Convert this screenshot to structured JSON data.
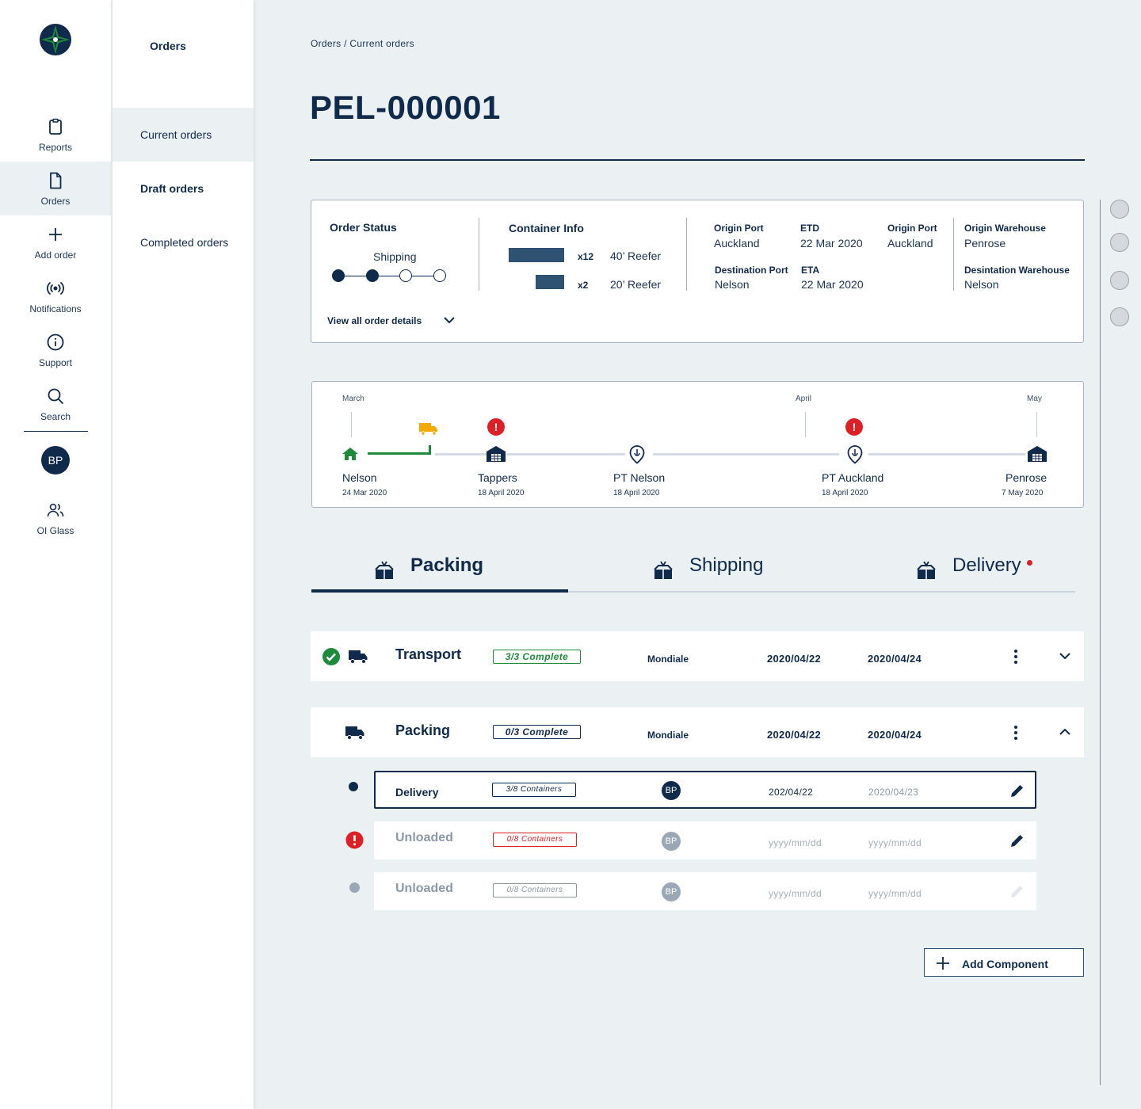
{
  "rail": {
    "items": [
      {
        "label": "Reports",
        "icon": "clipboard-icon"
      },
      {
        "label": "Orders",
        "icon": "document-icon"
      },
      {
        "label": "Add order",
        "icon": "plus-icon"
      },
      {
        "label": "Notifications",
        "icon": "broadcast-icon"
      },
      {
        "label": "Support",
        "icon": "info-icon"
      },
      {
        "label": "Search",
        "icon": "search-icon"
      }
    ],
    "user_initials": "BP",
    "org_label": "OI Glass"
  },
  "subnav": {
    "title": "Orders",
    "items": [
      {
        "label": "Current orders"
      },
      {
        "label": "Draft orders"
      },
      {
        "label": "Completed orders"
      }
    ]
  },
  "breadcrumb": "Orders / Current orders",
  "page_title": "PEL-000001",
  "order_info": {
    "status_label": "Order Status",
    "status_value": "Shipping",
    "status_steps_done": 2,
    "status_steps_total": 4,
    "view_details": "View all order details",
    "container_label": "Container Info",
    "containers": [
      {
        "qty": "x12",
        "type": "40’ Reefer"
      },
      {
        "qty": "x2",
        "type": "20’ Reefer"
      }
    ],
    "origin_port_label": "Origin Port",
    "origin_port": "Auckland",
    "etd_label": "ETD",
    "etd": "22 Mar 2020",
    "origin_port2_label": "Origin Port",
    "origin_port2": "Auckland",
    "dest_port_label": "Destination Port",
    "dest_port": "Nelson",
    "eta_label": "ETA",
    "eta": "22 Mar 2020",
    "origin_wh_label": "Origin Warehouse",
    "origin_wh": "Penrose",
    "dest_wh_label": "Desintation Warehouse",
    "dest_wh": "Nelson"
  },
  "timeline": {
    "months": [
      "March",
      "April",
      "May"
    ],
    "stops": [
      {
        "name": "Nelson",
        "date": "24 Mar 2020",
        "icon": "home-icon"
      },
      {
        "name": "Tappers",
        "date": "18 April 2020",
        "icon": "warehouse-icon",
        "alert": "!"
      },
      {
        "name": "PT Nelson",
        "date": "18 April 2020",
        "icon": "port-pin-icon"
      },
      {
        "name": "PT Auckland",
        "date": "18 April 2020",
        "icon": "port-pin-icon",
        "alert": "!"
      },
      {
        "name": "Penrose",
        "date": "7 May 2020",
        "icon": "warehouse-icon"
      }
    ]
  },
  "tabs": [
    {
      "label": "Packing",
      "active": true
    },
    {
      "label": "Shipping",
      "active": false
    },
    {
      "label": "Delivery",
      "active": false
    }
  ],
  "components": [
    {
      "title": "Transport",
      "status": "3/3 Complete",
      "company": "Mondiale",
      "start": "2020/04/22",
      "end": "2020/04/24"
    },
    {
      "title": "Packing",
      "status": "0/3 Complete",
      "company": "Mondiale",
      "start": "2020/04/22",
      "end": "2020/04/24"
    }
  ],
  "subtasks": [
    {
      "title": "Delivery",
      "containers": "3/8 Containers",
      "assignee": "BP",
      "start": "202/04/22",
      "end": "2020/04/23"
    },
    {
      "title": "Unloaded",
      "containers": "0/8 Containers",
      "assignee": "BP",
      "start": "yyyy/mm/dd",
      "end": "yyyy/mm/dd"
    },
    {
      "title": "Unloaded",
      "containers": "0/8 Containers",
      "assignee": "BP",
      "start": "yyyy/mm/dd",
      "end": "yyyy/mm/dd"
    }
  ],
  "add_component": "Add Component",
  "colors": {
    "navy": "#0f2a4a",
    "green": "#1e8a3c",
    "red": "#dd1f26",
    "amber": "#f2a900"
  }
}
